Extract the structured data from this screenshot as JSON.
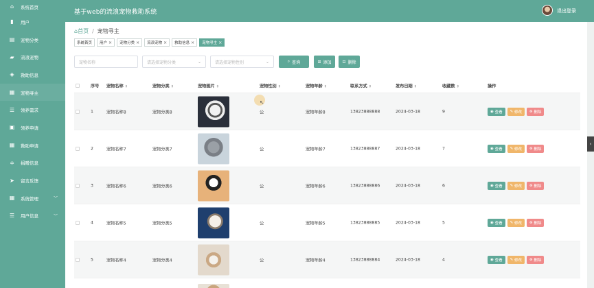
{
  "header": {
    "title": "基于web的流浪宠物救助系统",
    "logout": "退出登录"
  },
  "sidebar": {
    "items": [
      {
        "label": "系统首页",
        "icon": "home-icon"
      },
      {
        "label": "用户",
        "icon": "bar-chart-icon"
      },
      {
        "label": "宠物分类",
        "icon": "clipboard-icon"
      },
      {
        "label": "流浪宠物",
        "icon": "briefcase-icon"
      },
      {
        "label": "救助信息",
        "icon": "cube-icon"
      },
      {
        "label": "宠物寻主",
        "icon": "grid-icon"
      },
      {
        "label": "领养需求",
        "icon": "list-icon"
      },
      {
        "label": "领养申请",
        "icon": "calendar-icon"
      },
      {
        "label": "救助申请",
        "icon": "grid-icon"
      },
      {
        "label": "捐赠信息",
        "icon": "sliders-icon"
      },
      {
        "label": "留言反馈",
        "icon": "send-icon"
      },
      {
        "label": "系统管理",
        "icon": "grid-icon"
      },
      {
        "label": "用户信息",
        "icon": "list-icon"
      }
    ]
  },
  "breadcrumb": {
    "home": "首页",
    "current": "宠物寻主"
  },
  "tags": [
    "系统首页",
    "用户",
    "宠物分类",
    "流浪宠物",
    "救助信息",
    "宠物寻主"
  ],
  "search": {
    "name_placeholder": "宠物名称",
    "category_placeholder": "请选择宠物分类",
    "gender_placeholder": "请选择宠物性别",
    "query_btn": "查询",
    "add_btn": "添加",
    "delete_btn": "删除"
  },
  "table": {
    "headers": [
      "序号",
      "宠物名称",
      "宠物分类",
      "宠物图片",
      "宠物性别",
      "宠物年龄",
      "联系方式",
      "发布日期",
      "收藏数",
      "操作"
    ],
    "rows": [
      {
        "index": "1",
        "name": "宠物名称8",
        "category": "宠物分类8",
        "gender": "公",
        "age": "宠物年龄8",
        "phone": "13823888888",
        "date": "2024-03-18",
        "favorites": "9"
      },
      {
        "index": "2",
        "name": "宠物名称7",
        "category": "宠物分类7",
        "gender": "公",
        "age": "宠物年龄7",
        "phone": "13823888887",
        "date": "2024-03-18",
        "favorites": "7"
      },
      {
        "index": "3",
        "name": "宠物名称6",
        "category": "宠物分类6",
        "gender": "公",
        "age": "宠物年龄6",
        "phone": "13823888886",
        "date": "2024-03-18",
        "favorites": "6"
      },
      {
        "index": "4",
        "name": "宠物名称5",
        "category": "宠物分类5",
        "gender": "公",
        "age": "宠物年龄5",
        "phone": "13823888885",
        "date": "2024-03-18",
        "favorites": "5"
      },
      {
        "index": "5",
        "name": "宠物名称4",
        "category": "宠物分类4",
        "gender": "公",
        "age": "宠物年龄4",
        "phone": "13823888884",
        "date": "2024-03-18",
        "favorites": "4"
      }
    ],
    "ops": {
      "view": "查看",
      "edit": "修改",
      "delete": "删除"
    }
  },
  "colors": {
    "primary": "#5fa898",
    "edit": "#f0b66a",
    "delete": "#f08a8a"
  }
}
